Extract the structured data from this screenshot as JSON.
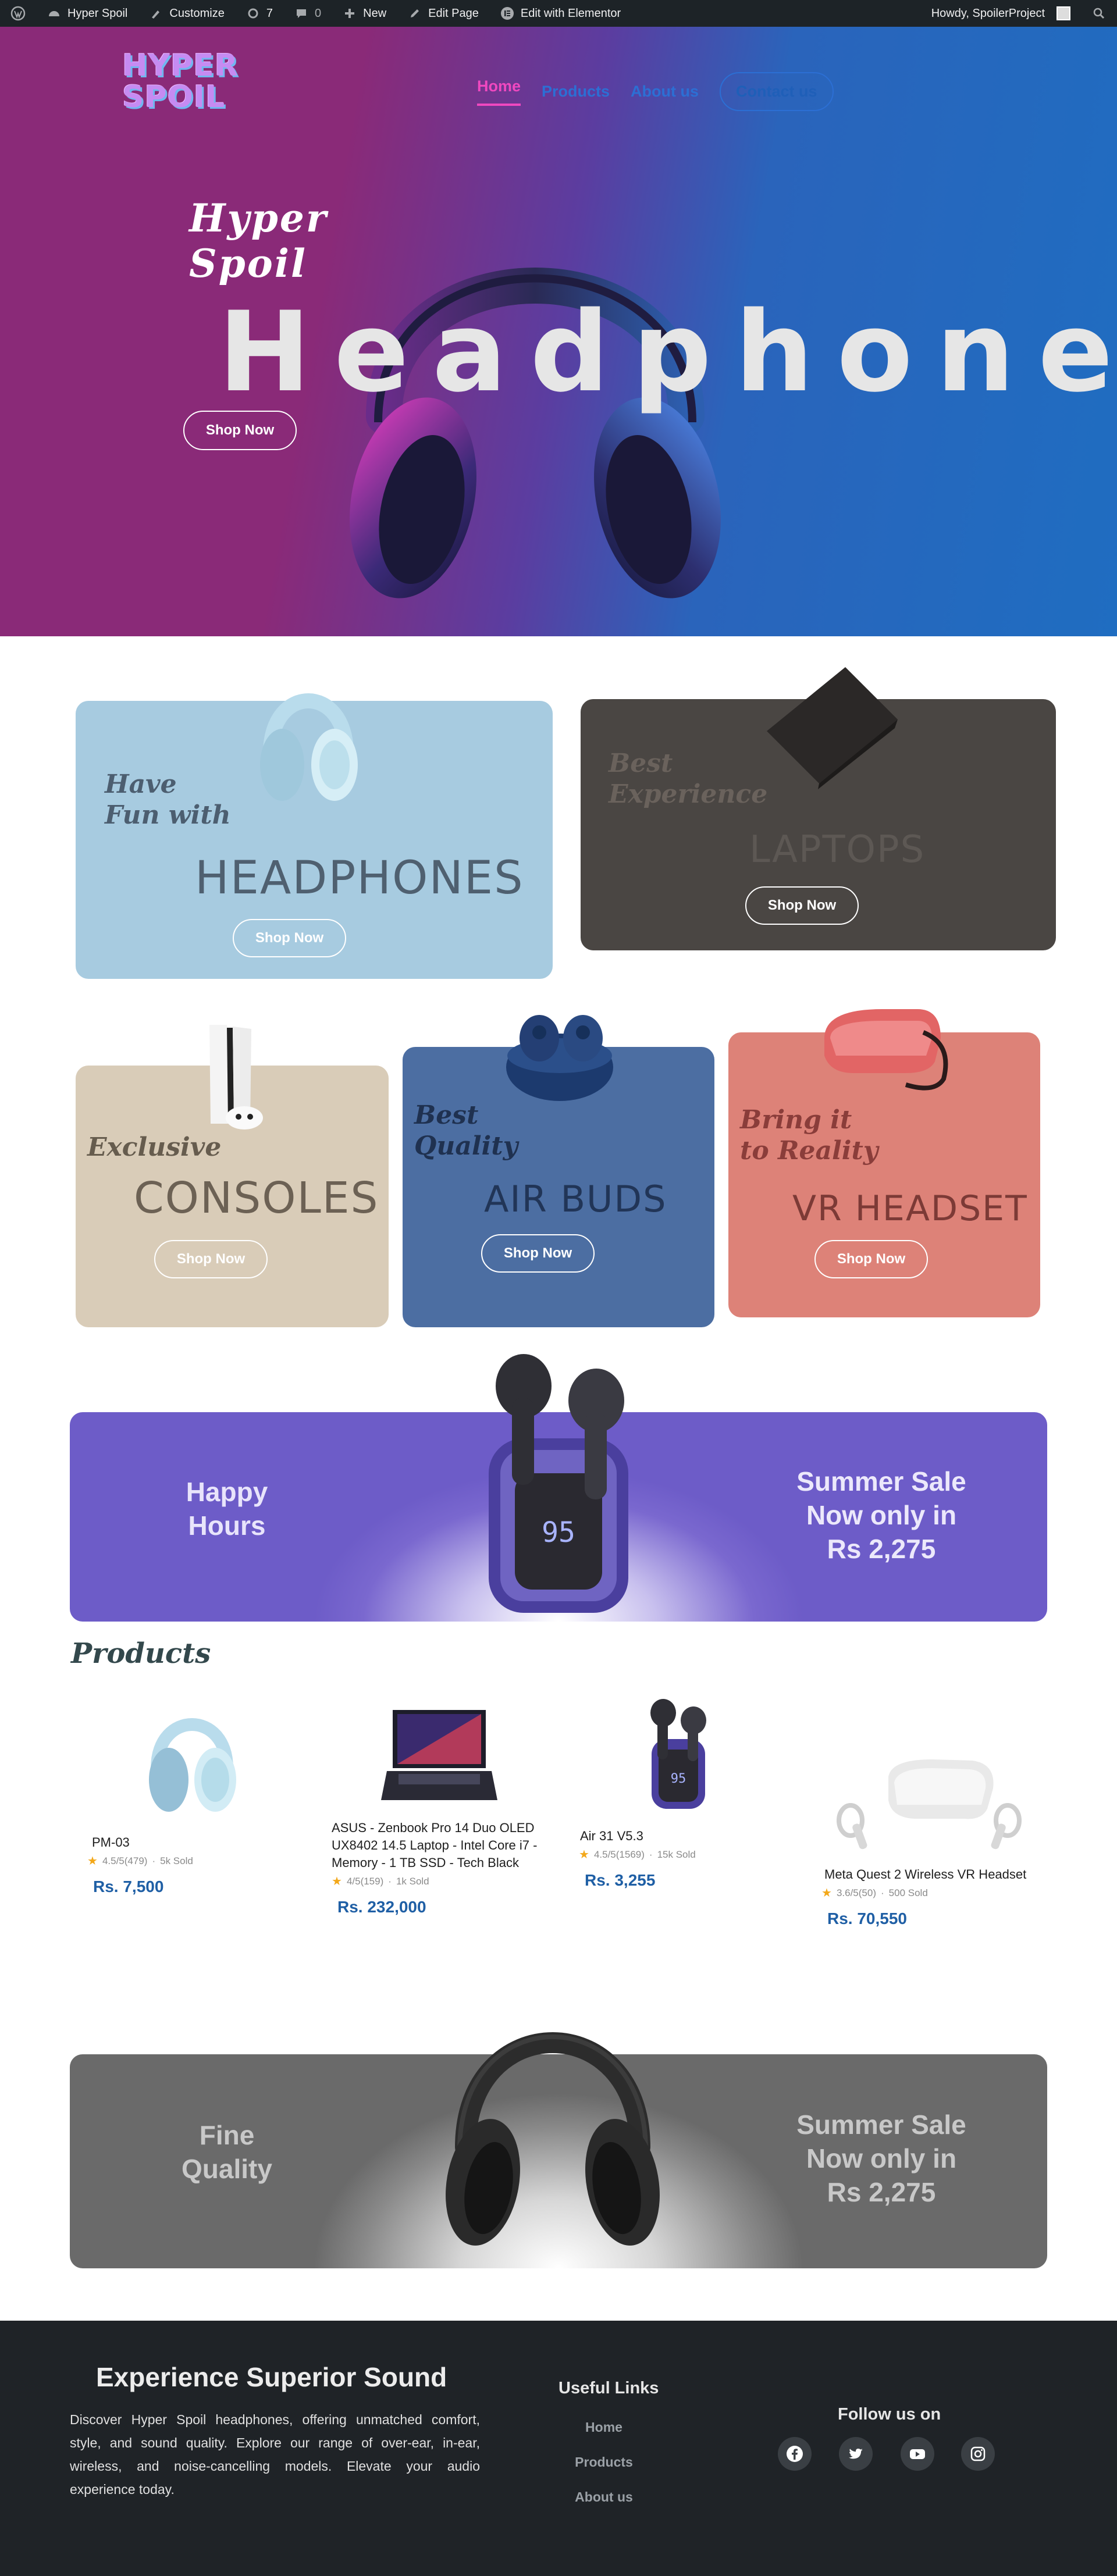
{
  "adminbar": {
    "site": "Hyper Spoil",
    "customize": "Customize",
    "updates": "7",
    "comments": "0",
    "new": "New",
    "edit_page": "Edit Page",
    "elementor": "Edit with Elementor",
    "howdy": "Howdy, SpoilerProject"
  },
  "hero": {
    "logo_line1": "HYPER",
    "logo_line2": "SPOIL",
    "nav": {
      "home": "Home",
      "products": "Products",
      "about": "About us",
      "contact": "Contact us"
    },
    "script_line1": "Hyper",
    "script_line2": "Spoil",
    "title": "Headphones",
    "cta": "Shop Now"
  },
  "cards": {
    "headphones": {
      "script1": "Have",
      "script2": "Fun with",
      "big": "HEADPHONES",
      "cta": "Shop Now"
    },
    "laptops": {
      "script1": "Best",
      "script2": "Experience",
      "big": "LAPTOPS",
      "cta": "Shop Now"
    },
    "consoles": {
      "script1": "Exclusive",
      "big": "CONSOLES",
      "cta": "Shop Now"
    },
    "airbuds": {
      "script1": "Best",
      "script2": "Quality",
      "big": "AIR BUDS",
      "cta": "Shop Now"
    },
    "vr": {
      "script1": "Bring it",
      "script2": "to Reality",
      "big": "VR HEADSET",
      "cta": "Shop Now"
    }
  },
  "banner1": {
    "left1": "Happy",
    "left2": "Hours",
    "right1": "Summer Sale",
    "right2": "Now only in",
    "right3": "Rs 2,275",
    "case_display": "95"
  },
  "products": {
    "title": "Products",
    "items": [
      {
        "name": "PM-03",
        "rating": "4.5/5(479)",
        "sold": "5k Sold",
        "price": "Rs. 7,500"
      },
      {
        "name": "ASUS - Zenbook Pro 14 Duo OLED UX8402 14.5 Laptop - Intel Core i7 - Memory - 1 TB SSD - Tech Black",
        "rating": "4/5(159)",
        "sold": "1k Sold",
        "price": "Rs. 232,000"
      },
      {
        "name": "Air 31 V5.3",
        "rating": "4.5/5(1569)",
        "sold": "15k Sold",
        "price": "Rs. 3,255",
        "case_display": "95"
      },
      {
        "name": "Meta Quest 2 Wireless VR Headset",
        "rating": "3.6/5(50)",
        "sold": "500 Sold",
        "price": "Rs. 70,550"
      }
    ]
  },
  "banner2": {
    "left1": "Fine",
    "left2": "Quality",
    "right1": "Summer Sale",
    "right2": "Now only in",
    "right3": "Rs 2,275"
  },
  "footer": {
    "title": "Experience Superior Sound",
    "text": "Discover Hyper Spoil headphones, offering unmatched comfort, style, and sound quality. Explore our range of over-ear, in-ear, wireless, and noise-cancelling models. Elevate your audio experience today.",
    "links_title": "Useful Links",
    "links": [
      "Home",
      "Products",
      "About us"
    ],
    "follow": "Follow us on",
    "social": [
      "facebook-icon",
      "twitter-icon",
      "youtube-icon",
      "instagram-icon"
    ]
  }
}
